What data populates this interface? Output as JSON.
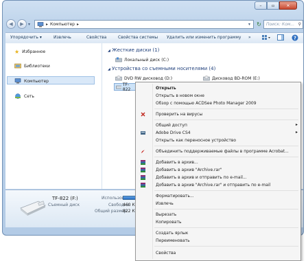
{
  "window": {
    "address_root": "Компьютер",
    "address_sep": "▸",
    "search_placeholder": "Поиск: Ком...",
    "min_label": "–",
    "max_label": "▫",
    "close_label": "✕"
  },
  "toolbar": {
    "organize": "Упорядочить ▾",
    "eject": "Извлечь",
    "properties": "Свойства",
    "sysprops": "Свойства системы",
    "uninstall": "Удалить или изменить программу",
    "more": "»"
  },
  "nav": {
    "favorites": "Избранное",
    "libraries": "Библиотеки",
    "computer": "Компьютер",
    "network": "Сеть"
  },
  "content": {
    "hdd_header": "Жесткие диски (1)",
    "local_disk": "Локальный диск (C:)",
    "removable_header": "Устройства со съемными носителями (4)",
    "dvd": "DVD RW дисковод (D:)",
    "bd": "Дисковод BD-ROM (E:)",
    "tf": "TF-822"
  },
  "details": {
    "name": "TF-822 (F:)",
    "type": "Съемный диск",
    "used_label": "Использовано:",
    "free_label": "Свободно:",
    "free_value": "460 КБ",
    "total_label": "Общий размер:",
    "total_value": "822 КБ"
  },
  "menu": {
    "items": [
      {
        "label": "Открыть",
        "bold": true
      },
      {
        "label": "Открыть в новом окне"
      },
      {
        "label": "Обзор с помощью ACDSee Photo Manager 2009"
      },
      {
        "label": "Проверить на вирусы"
      },
      {
        "label": "Общий доступ"
      },
      {
        "label": "Adobe Drive CS4"
      },
      {
        "label": "Открыть как переносное устройство"
      },
      {
        "label": "Объединить поддерживаемые файлы в программе Acrobat..."
      },
      {
        "label": "Добавить в архив..."
      },
      {
        "label": "Добавить в архив \"Archive.rar\""
      },
      {
        "label": "Добавить в архив и отправить по e-mail..."
      },
      {
        "label": "Добавить в архив \"Archive.rar\" и отправить по e-mail"
      },
      {
        "label": "Форматировать..."
      },
      {
        "label": "Извлечь"
      },
      {
        "label": "Вырезать"
      },
      {
        "label": "Копировать"
      },
      {
        "label": "Создать ярлык"
      },
      {
        "label": "Переименовать"
      },
      {
        "label": "Свойства"
      }
    ],
    "submenu_arrow": "▸"
  }
}
